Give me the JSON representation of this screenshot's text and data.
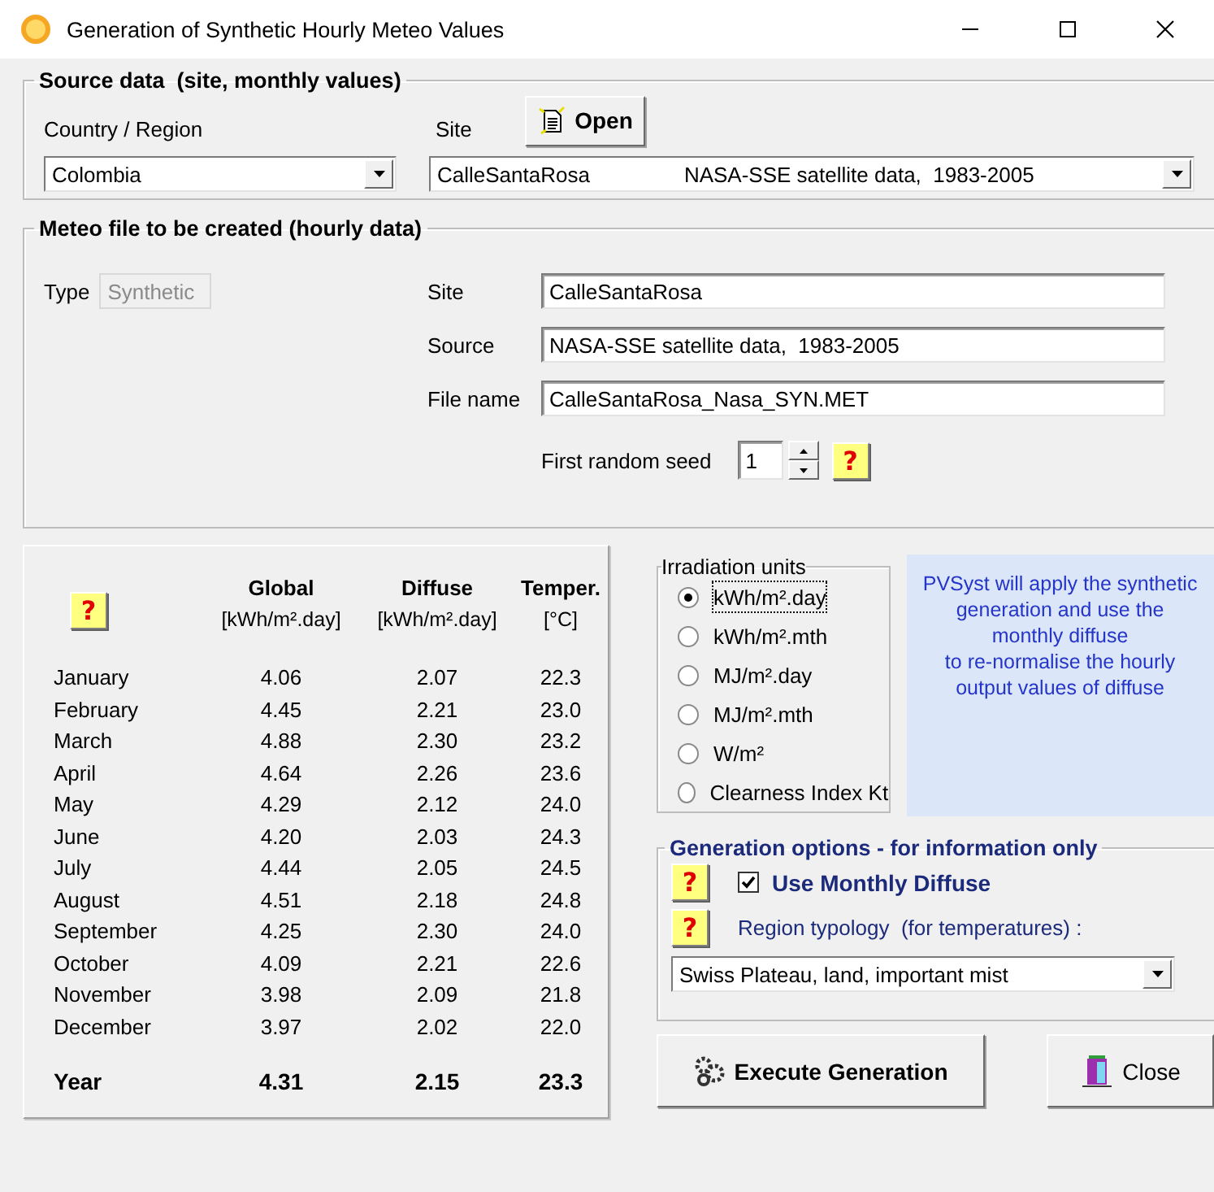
{
  "window": {
    "title": "Generation of Synthetic Hourly Meteo Values"
  },
  "source_data": {
    "title": "Source data  (site, monthly values)",
    "country_label": "Country / Region",
    "country": "Colombia",
    "site_label": "Site",
    "open_button": "Open",
    "site": "CalleSantaRosa",
    "site_source": "NASA-SSE satellite data,  1983-2005"
  },
  "meteo_file": {
    "title": "Meteo file to be created (hourly data)",
    "type_label": "Type",
    "type": "Synthetic",
    "site_label": "Site",
    "site": "CalleSantaRosa",
    "source_label": "Source",
    "source": "NASA-SSE satellite data,  1983-2005",
    "file_name_label": "File name",
    "file_name": "CalleSantaRosa_Nasa_SYN.MET",
    "seed_label": "First random seed",
    "seed": "1",
    "help": "?"
  },
  "table": {
    "help": "?",
    "columns": [
      {
        "name": "Global",
        "unit": "[kWh/m².day]"
      },
      {
        "name": "Diffuse",
        "unit": "[kWh/m².day]"
      },
      {
        "name": "Temper.",
        "unit": "[°C]"
      }
    ],
    "rows": [
      {
        "month": "January",
        "values": [
          "4.06",
          "2.07",
          "22.3"
        ]
      },
      {
        "month": "February",
        "values": [
          "4.45",
          "2.21",
          "23.0"
        ]
      },
      {
        "month": "March",
        "values": [
          "4.88",
          "2.30",
          "23.2"
        ]
      },
      {
        "month": "April",
        "values": [
          "4.64",
          "2.26",
          "23.6"
        ]
      },
      {
        "month": "May",
        "values": [
          "4.29",
          "2.12",
          "24.0"
        ]
      },
      {
        "month": "June",
        "values": [
          "4.20",
          "2.03",
          "24.3"
        ]
      },
      {
        "month": "July",
        "values": [
          "4.44",
          "2.05",
          "24.5"
        ]
      },
      {
        "month": "August",
        "values": [
          "4.51",
          "2.18",
          "24.8"
        ]
      },
      {
        "month": "September",
        "values": [
          "4.25",
          "2.30",
          "24.0"
        ]
      },
      {
        "month": "October",
        "values": [
          "4.09",
          "2.21",
          "22.6"
        ]
      },
      {
        "month": "November",
        "values": [
          "3.98",
          "2.09",
          "21.8"
        ]
      },
      {
        "month": "December",
        "values": [
          "3.97",
          "2.02",
          "22.0"
        ]
      }
    ],
    "total": {
      "label": "Year",
      "values": [
        "4.31",
        "2.15",
        "23.3"
      ]
    }
  },
  "irradiation_units": {
    "title": "Irradiation units",
    "options": [
      {
        "label": "kWh/m².day",
        "selected": true
      },
      {
        "label": "kWh/m².mth",
        "selected": false
      },
      {
        "label": "MJ/m².day",
        "selected": false
      },
      {
        "label": "MJ/m².mth",
        "selected": false
      },
      {
        "label": "W/m²",
        "selected": false
      },
      {
        "label": "Clearness Index Kt",
        "selected": false
      }
    ]
  },
  "info": "PVSyst will apply the synthetic\ngeneration and use the\nmonthly diffuse\nto re-normalise the hourly\noutput values of diffuse",
  "generation_options": {
    "title": "Generation options - for information only",
    "help_diffuse": "?",
    "use_monthly_diffuse": {
      "label": "Use Monthly Diffuse",
      "checked": true
    },
    "help_region": "?",
    "region_label": "Region typology  (for temperatures) :",
    "region": "Swiss Plateau, land, important mist"
  },
  "buttons": [
    {
      "label": "Execute Generation",
      "kind": "execute"
    },
    {
      "label": "Close",
      "kind": "close"
    }
  ]
}
